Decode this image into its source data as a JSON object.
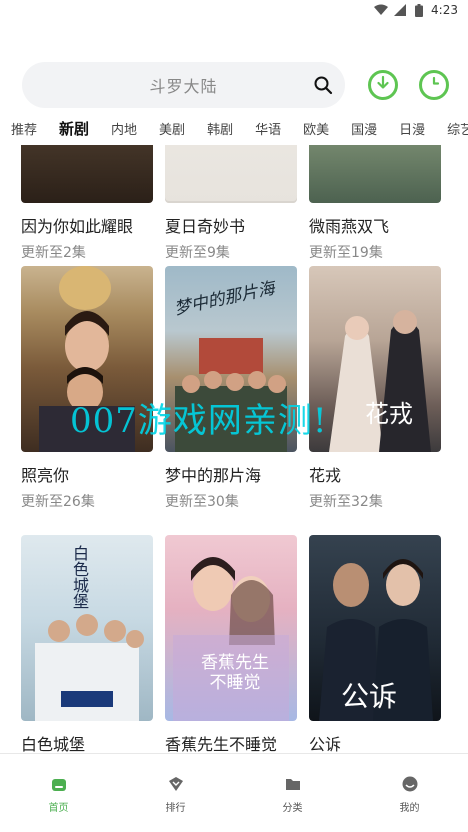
{
  "status_bar": {
    "time": "4:23",
    "icons": [
      "wifi-icon",
      "signal-icon",
      "battery-icon"
    ]
  },
  "search": {
    "placeholder": "斗罗大陆"
  },
  "header_buttons": [
    {
      "icon": "download-icon",
      "color": "#5ec552"
    },
    {
      "icon": "history-clock-icon",
      "color": "#5ec552"
    }
  ],
  "tabs": [
    {
      "label": "推荐",
      "active": false
    },
    {
      "label": "新剧",
      "active": true
    },
    {
      "label": "内地",
      "active": false
    },
    {
      "label": "美剧",
      "active": false
    },
    {
      "label": "韩剧",
      "active": false
    },
    {
      "label": "华语",
      "active": false
    },
    {
      "label": "欧美",
      "active": false
    },
    {
      "label": "国漫",
      "active": false
    },
    {
      "label": "日漫",
      "active": false
    },
    {
      "label": "综艺",
      "active": false
    }
  ],
  "cards": [
    {
      "title": "因为你如此耀眼",
      "update": "更新至2集"
    },
    {
      "title": "夏日奇妙书",
      "update": "更新至9集"
    },
    {
      "title": "微雨燕双飞",
      "update": "更新至19集"
    },
    {
      "title": "照亮你",
      "update": "更新至26集"
    },
    {
      "title": "梦中的那片海",
      "update": "更新至30集",
      "poster_text": "梦中的那片海"
    },
    {
      "title": "花戎",
      "update": "更新至32集",
      "poster_text": "花戎"
    },
    {
      "title": "白色城堡",
      "update": "",
      "poster_text": "白色城堡"
    },
    {
      "title": "香蕉先生不睡觉",
      "update": "",
      "poster_text": "香蕉先生不睡觉"
    },
    {
      "title": "公诉",
      "update": "",
      "poster_text": "公诉"
    }
  ],
  "watermark": "007游戏网亲测!",
  "bottom_nav": [
    {
      "label": "首页",
      "icon": "home-icon",
      "active": true
    },
    {
      "label": "排行",
      "icon": "ranking-icon",
      "active": false
    },
    {
      "label": "分类",
      "icon": "folder-icon",
      "active": false
    },
    {
      "label": "我的",
      "icon": "profile-icon",
      "active": false
    }
  ],
  "colors": {
    "accent": "#5ec552",
    "nav_active": "#4caf50"
  }
}
